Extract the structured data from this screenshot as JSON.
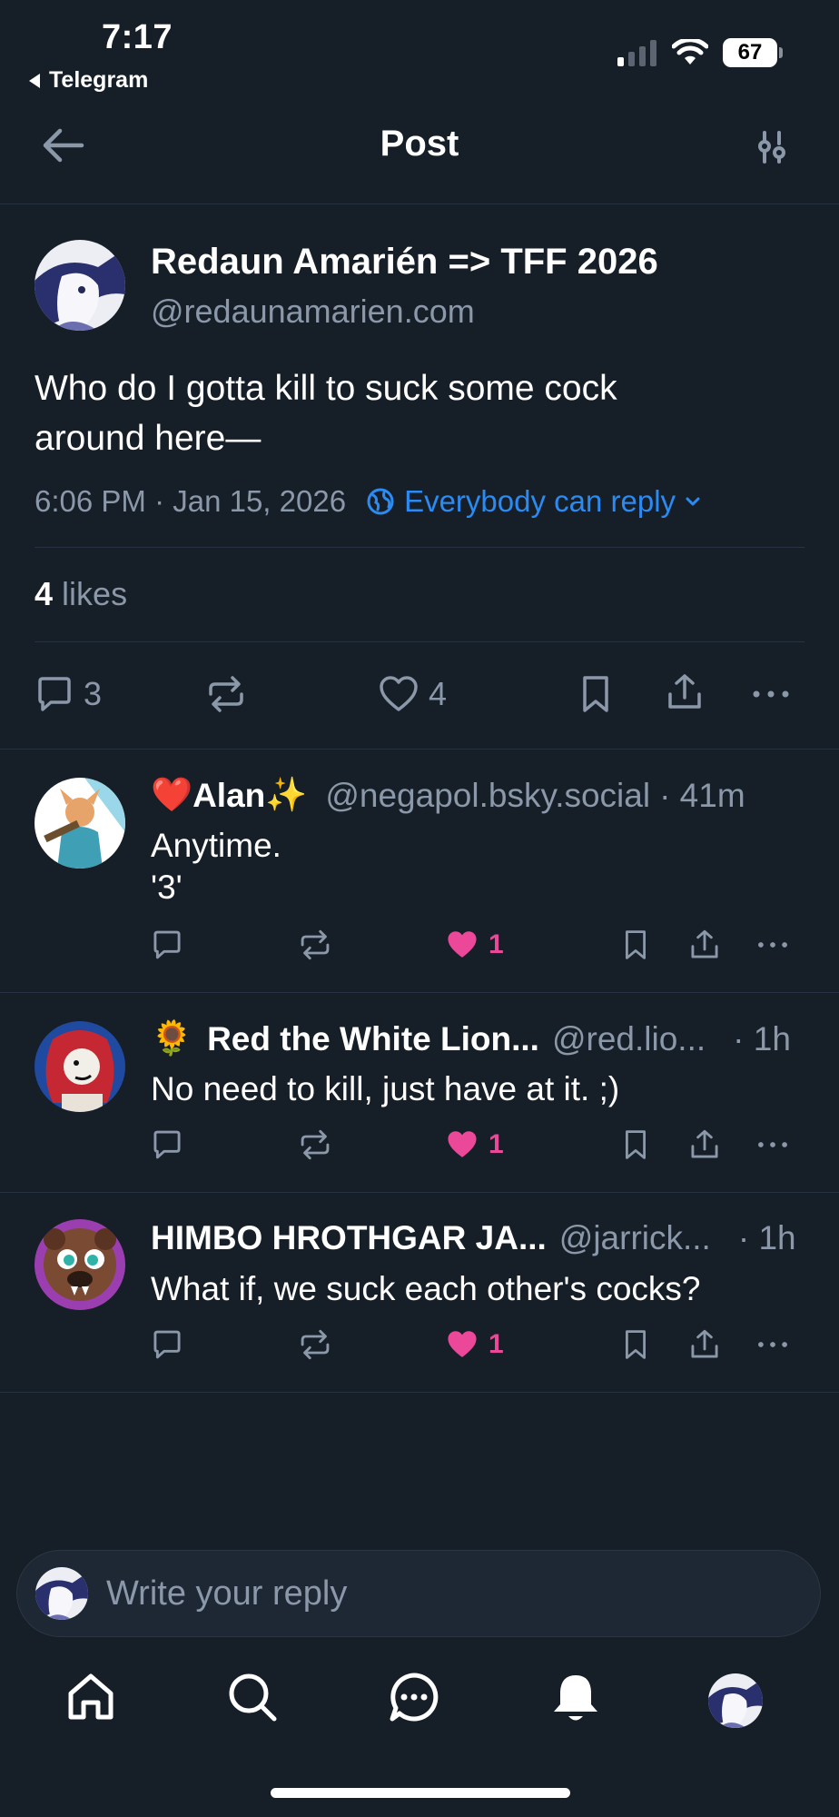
{
  "status_bar": {
    "time": "7:17",
    "back_app": "Telegram",
    "battery": "67"
  },
  "header": {
    "title": "Post"
  },
  "post": {
    "author_name": "Redaun Amarién => TFF 2026",
    "author_handle": "@redaunamarien.com",
    "text_line1": "Who do I gotta kill to suck some cock",
    "text_line2": "around here—",
    "timestamp": "6:06 PM · Jan 15, 2026",
    "reply_setting": "Everybody can reply",
    "likes_count": "4",
    "likes_label": "likes",
    "reply_count": "3",
    "like_count": "4"
  },
  "replies": [
    {
      "name_prefix": "❤️",
      "name": "Alan",
      "name_suffix": "✨",
      "handle": "@negapol.bsky.social",
      "time": "· 41m",
      "text_line1": "Anytime.",
      "text_line2": "'3'",
      "likes": "1"
    },
    {
      "name_prefix": "🌻",
      "name": "Red the White Lion...",
      "name_suffix": "",
      "handle": "@red.lio...",
      "time": "· 1h",
      "text_line1": "No need to kill, just have at it. ;)",
      "text_line2": "",
      "likes": "1"
    },
    {
      "name_prefix": "",
      "name": "HIMBO HROTHGAR JA...",
      "name_suffix": "",
      "handle": "@jarrick...",
      "time": "· 1h",
      "text_line1": "What if, we suck each other's cocks?",
      "text_line2": "",
      "likes": "1"
    }
  ],
  "composer": {
    "placeholder": "Write your reply"
  },
  "colors": {
    "background": "#161e27",
    "accent": "#2b8bf2",
    "like_pink": "#ec4899",
    "muted": "#8b98a9"
  },
  "nav": [
    "home-icon",
    "search-icon",
    "chat-icon",
    "bell-icon",
    "profile-avatar"
  ]
}
